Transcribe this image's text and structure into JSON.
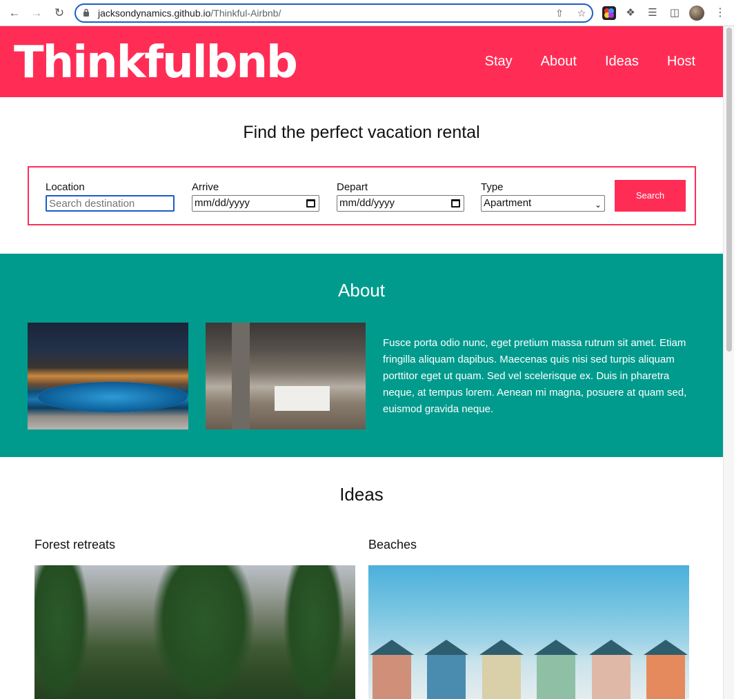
{
  "browser": {
    "url_host": "jacksondynamics.github.io",
    "url_path": "/Thinkful-Airbnb/"
  },
  "header": {
    "logo": "Thinkfulbnb",
    "nav": [
      "Stay",
      "About",
      "Ideas",
      "Host"
    ]
  },
  "search": {
    "title": "Find the perfect vacation rental",
    "location_label": "Location",
    "location_placeholder": "Search destination",
    "arrive_label": "Arrive",
    "arrive_value": "mm/dd/yyyy",
    "depart_label": "Depart",
    "depart_value": "mm/dd/yyyy",
    "type_label": "Type",
    "type_value": "Apartment",
    "button": "Search"
  },
  "about": {
    "title": "About",
    "text": "Fusce porta odio nunc, eget pretium massa rutrum sit amet. Etiam fringilla aliquam dapibus. Maecenas quis nisi sed turpis aliquam porttitor eget ut quam. Sed vel scelerisque ex. Duis in pharetra neque, at tempus lorem. Aenean mi magna, posuere at quam sed, euismod gravida neque."
  },
  "ideas": {
    "title": "Ideas",
    "items": [
      {
        "caption": "Forest retreats"
      },
      {
        "caption": "Beaches"
      }
    ]
  },
  "colors": {
    "brand": "#ff2d55",
    "about_bg": "#009b8d"
  }
}
